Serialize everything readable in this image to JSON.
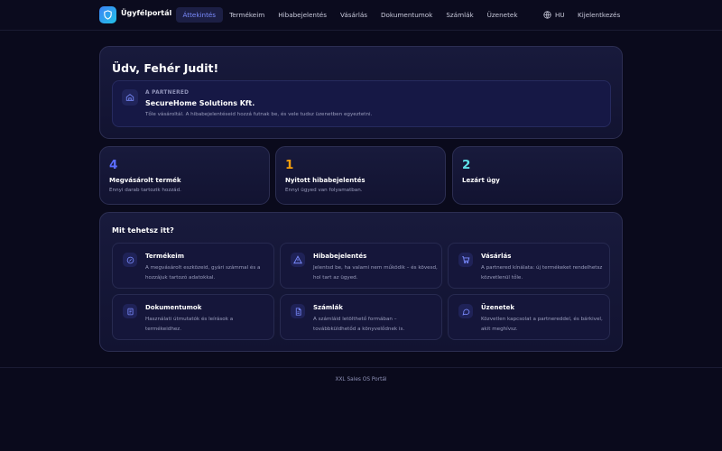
{
  "header": {
    "app_name": "Ügyfélportál",
    "nav": [
      {
        "label": "Áttekintés",
        "active": true
      },
      {
        "label": "Termékeim",
        "active": false
      },
      {
        "label": "Hibabejelentés",
        "active": false
      },
      {
        "label": "Vásárlás",
        "active": false
      },
      {
        "label": "Dokumentumok",
        "active": false
      },
      {
        "label": "Számlák",
        "active": false
      },
      {
        "label": "Üzenetek",
        "active": false
      }
    ],
    "language": "HU",
    "logout_label": "Kijelentkezés"
  },
  "welcome": {
    "title": "Üdv, Fehér Judit!",
    "partner_kicker": "A PARTNERED",
    "partner_name": "SecureHome Solutions Kft.",
    "partner_desc": "Tőle vásároltál. A hibabejelentéseid hozzá futnak be, és vele tudsz üzenetben egyeztetni."
  },
  "stats": [
    {
      "value": "4",
      "label": "Megvásárolt termék",
      "desc": "Ennyi darab tartozik hozzád.",
      "color": "#5b6cff"
    },
    {
      "value": "1",
      "label": "Nyitott hibabejelentés",
      "desc": "Ennyi ügyed van folyamatban.",
      "color": "#f59e0b"
    },
    {
      "value": "2",
      "label": "Lezárt ügy",
      "desc": "",
      "color": "#5ee0e8"
    }
  ],
  "actions": {
    "title": "Mit tehetsz itt?",
    "tiles": [
      {
        "title": "Termékeim",
        "desc": "A megvásárolt eszközeid, gyári számmal és a hozzájuk tartozó adatokkal.",
        "icon": "tag-icon"
      },
      {
        "title": "Hibabejelentés",
        "desc": "Jelentsd be, ha valami nem működik – és kövesd, hol tart az ügyed.",
        "icon": "warning-icon"
      },
      {
        "title": "Vásárlás",
        "desc": "A partnered kínálata: új termékeket rendelhetsz közvetlenül tőle.",
        "icon": "cart-icon"
      },
      {
        "title": "Dokumentumok",
        "desc": "Használati útmutatók és leírások a termékeidhez.",
        "icon": "document-icon"
      },
      {
        "title": "Számlák",
        "desc": "A számláid letölthető formában – továbbküldhetőd a könyvelődnek is.",
        "icon": "invoice-icon"
      },
      {
        "title": "Üzenetek",
        "desc": "Közvetlen kapcsolat a partnereddel, és bárkivel, akit meghívsz.",
        "icon": "chat-icon"
      }
    ]
  },
  "footer": {
    "text": "XXL Sales OS Portál"
  },
  "colors": {
    "accent": "#5b6cff",
    "background": "#0a0a1c"
  }
}
